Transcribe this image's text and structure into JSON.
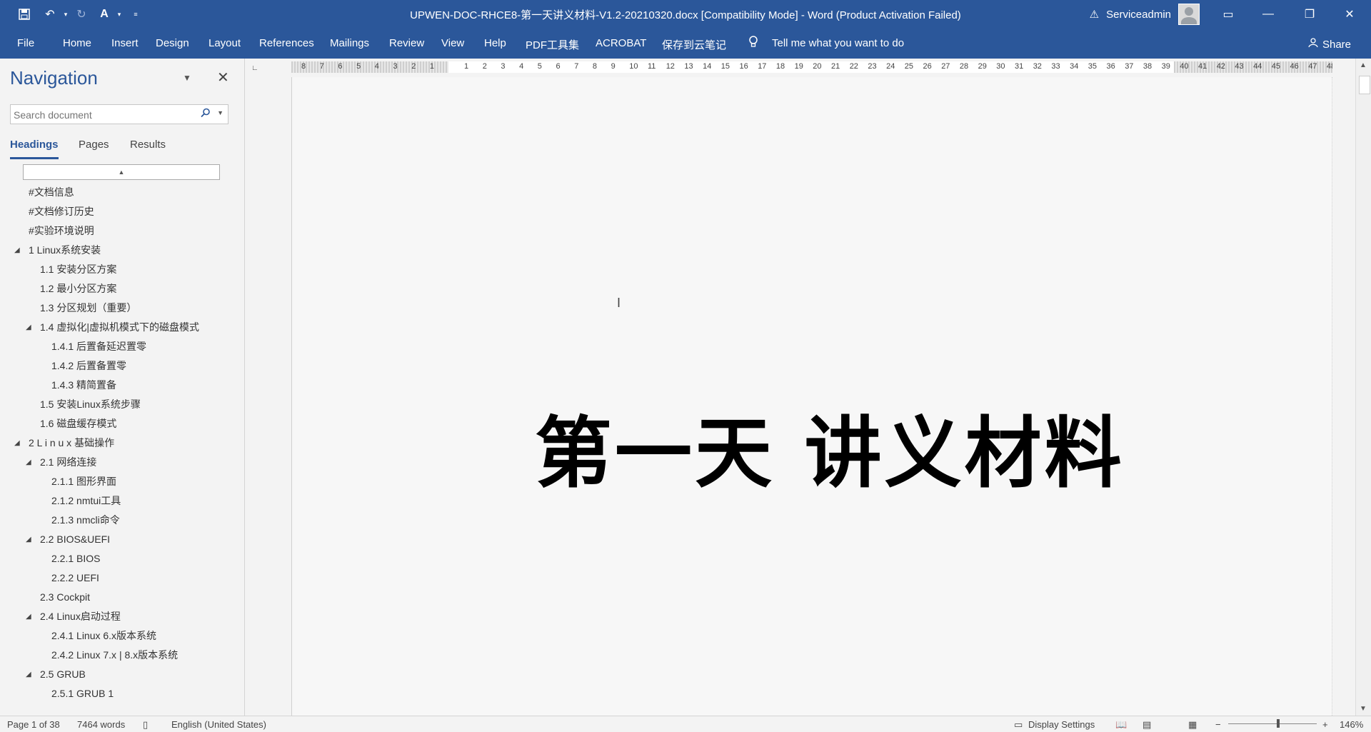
{
  "titlebar": {
    "title": "UPWEN-DOC-RHCE8-第一天讲义材料-V1.2-20210320.docx [Compatibility Mode]  -  Word (Product Activation Failed)",
    "user": "Serviceadmin"
  },
  "ribbon": {
    "tabs": [
      "File",
      "Home",
      "Insert",
      "Design",
      "Layout",
      "References",
      "Mailings",
      "Review",
      "View",
      "Help",
      "PDF工具集",
      "ACROBAT",
      "保存到云笔记"
    ],
    "tell_me": "Tell me what you want to do",
    "share": "Share"
  },
  "nav": {
    "title": "Navigation",
    "search_placeholder": "Search document",
    "tabs": [
      "Headings",
      "Pages",
      "Results"
    ],
    "active_tab": "Headings",
    "headings": [
      {
        "text": "#文档信息",
        "level": 0,
        "expander": false
      },
      {
        "text": "#文档修订历史",
        "level": 0,
        "expander": false
      },
      {
        "text": "#实验环境说明",
        "level": 0,
        "expander": false
      },
      {
        "text": "1 Linux系统安装",
        "level": 0,
        "expander": true
      },
      {
        "text": "1.1 安装分区方案",
        "level": 1,
        "expander": false
      },
      {
        "text": "1.2 最小分区方案",
        "level": 1,
        "expander": false
      },
      {
        "text": "1.3 分区规划（重要）",
        "level": 1,
        "expander": false
      },
      {
        "text": "1.4 虚拟化|虚拟机模式下的磁盘模式",
        "level": 1,
        "expander": true
      },
      {
        "text": "1.4.1 后置备延迟置零",
        "level": 2,
        "expander": false
      },
      {
        "text": "1.4.2 后置备置零",
        "level": 2,
        "expander": false
      },
      {
        "text": "1.4.3 精简置备",
        "level": 2,
        "expander": false
      },
      {
        "text": "1.5 安装Linux系统步骤",
        "level": 1,
        "expander": false
      },
      {
        "text": "1.6 磁盘缓存模式",
        "level": 1,
        "expander": false
      },
      {
        "text": "2 L i n u x 基础操作",
        "level": 0,
        "expander": true
      },
      {
        "text": "2.1 网络连接",
        "level": 1,
        "expander": true
      },
      {
        "text": "2.1.1 图形界面",
        "level": 2,
        "expander": false
      },
      {
        "text": "2.1.2 nmtui工具",
        "level": 2,
        "expander": false
      },
      {
        "text": "2.1.3 nmcli命令",
        "level": 2,
        "expander": false
      },
      {
        "text": "2.2 BIOS&UEFI",
        "level": 1,
        "expander": true
      },
      {
        "text": "2.2.1  BIOS",
        "level": 2,
        "expander": false
      },
      {
        "text": "2.2.2  UEFI",
        "level": 2,
        "expander": false
      },
      {
        "text": "2.3 Cockpit",
        "level": 1,
        "expander": false
      },
      {
        "text": "2.4 Linux启动过程",
        "level": 1,
        "expander": true
      },
      {
        "text": "2.4.1  Linux 6.x版本系统",
        "level": 2,
        "expander": false
      },
      {
        "text": "2.4.2  Linux 7.x | 8.x版本系统",
        "level": 2,
        "expander": false
      },
      {
        "text": "2.5 GRUB",
        "level": 1,
        "expander": true
      },
      {
        "text": "2.5.1 GRUB 1",
        "level": 2,
        "expander": false
      }
    ]
  },
  "ruler": {
    "left_numbers": [
      "8",
      "7",
      "6",
      "5",
      "4",
      "3",
      "2",
      "1"
    ],
    "numbers": [
      "1",
      "2",
      "3",
      "4",
      "5",
      "6",
      "7",
      "8",
      "9",
      "10",
      "11",
      "12",
      "13",
      "14",
      "15",
      "16",
      "17",
      "18",
      "19",
      "20",
      "21",
      "22",
      "23",
      "24",
      "25",
      "26",
      "27",
      "28",
      "29",
      "30",
      "31",
      "32",
      "33",
      "34",
      "35",
      "36",
      "37",
      "38",
      "39",
      "40",
      "41",
      "42",
      "43",
      "44",
      "45",
      "46",
      "47",
      "48"
    ]
  },
  "document": {
    "heading": "第一天  讲义材料"
  },
  "statusbar": {
    "page": "Page 1 of 38",
    "words": "7464 words",
    "language": "English (United States)",
    "display_settings": "Display Settings",
    "zoom": "146%"
  },
  "icons": {
    "save": "save-icon",
    "undo": "undo-icon",
    "redo": "redo-icon",
    "format_painter": "format-painter-icon",
    "warning": "warning-icon",
    "lightbulb": "lightbulb-icon"
  },
  "colors": {
    "ribbon": "#2b579a",
    "accent": "#2b579a"
  }
}
